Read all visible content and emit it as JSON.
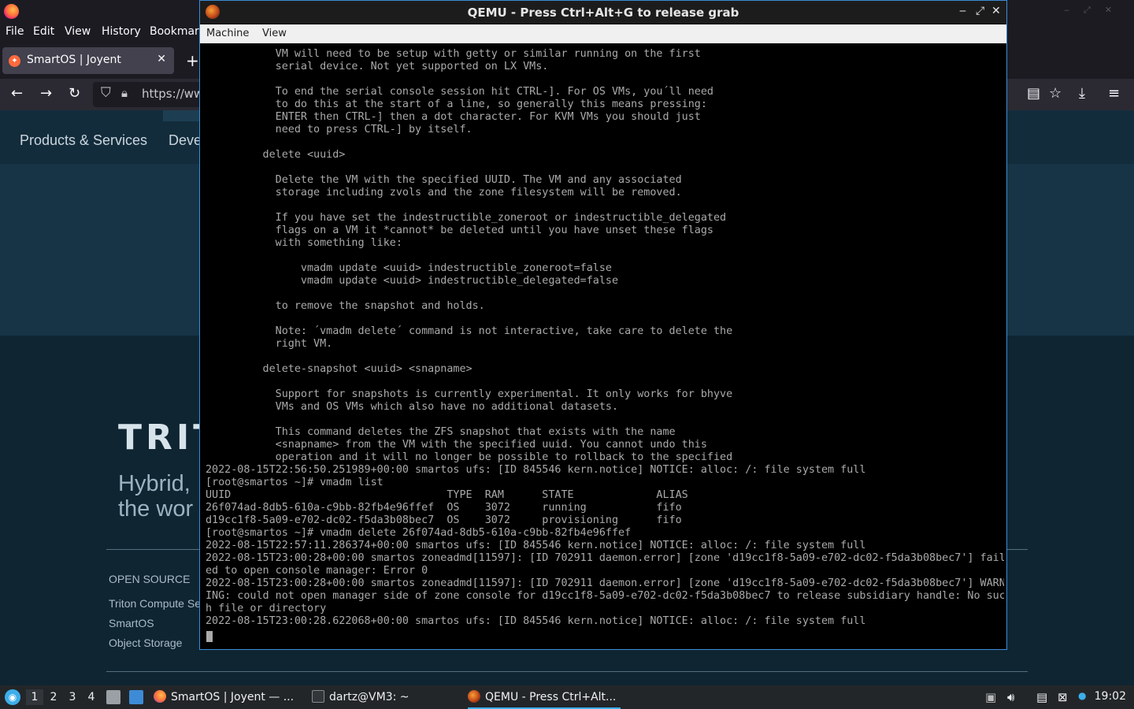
{
  "firefox": {
    "menu": [
      "File",
      "Edit",
      "View",
      "History",
      "Bookmarks"
    ],
    "tab_title": "SmartOS | Joyent",
    "tab_close": "✕",
    "new_tab": "+",
    "url": "https://www",
    "nav_icons": {
      "back": "←",
      "forward": "→",
      "reload": "↻",
      "reader": "▤",
      "bookmark": "☆",
      "download": "⤓",
      "menu": "≡"
    }
  },
  "page": {
    "nav": [
      "Products & Services",
      "Deve"
    ],
    "logo": "TRIT",
    "hero_lines": [
      "Hybrid,",
      "the wor"
    ],
    "open_source_heading": "OPEN SOURCE",
    "open_source_links": [
      "Triton Compute Se",
      "SmartOS",
      "Object Storage"
    ]
  },
  "qemu": {
    "title": "QEMU - Press Ctrl+Alt+G to release grab",
    "controls": {
      "minimize": "‒",
      "maximize": "⤢",
      "close": "✕"
    },
    "menu": [
      "Machine",
      "View"
    ],
    "console_lines": [
      "           VM will need to be setup with getty or similar running on the first",
      "           serial device. Not yet supported on LX VMs.",
      "",
      "           To end the serial console session hit CTRL-]. For OS VMs, you´ll need",
      "           to do this at the start of a line, so generally this means pressing:",
      "           ENTER then CTRL-] then a dot character. For KVM VMs you should just",
      "           need to press CTRL-] by itself.",
      "",
      "         delete <uuid>",
      "",
      "           Delete the VM with the specified UUID. The VM and any associated",
      "           storage including zvols and the zone filesystem will be removed.",
      "",
      "           If you have set the indestructible_zoneroot or indestructible_delegated",
      "           flags on a VM it *cannot* be deleted until you have unset these flags",
      "           with something like:",
      "",
      "               vmadm update <uuid> indestructible_zoneroot=false",
      "               vmadm update <uuid> indestructible_delegated=false",
      "",
      "           to remove the snapshot and holds.",
      "",
      "           Note: ´vmadm delete´ command is not interactive, take care to delete the",
      "           right VM.",
      "",
      "         delete-snapshot <uuid> <snapname>",
      "",
      "           Support for snapshots is currently experimental. It only works for bhyve",
      "           VMs and OS VMs which also have no additional datasets.",
      "",
      "           This command deletes the ZFS snapshot that exists with the name",
      "           <snapname> from the VM with the specified uuid. You cannot undo this",
      "           operation and it will no longer be possible to rollback to the specified",
      "2022-08-15T22:56:50.251989+00:00 smartos ufs: [ID 845546 kern.notice] NOTICE: alloc: /: file system full",
      "[root@smartos ~]# vmadm list",
      "UUID                                  TYPE  RAM      STATE             ALIAS",
      "26f074ad-8db5-610a-c9bb-82fb4e96ffef  OS    3072     running           fifo",
      "d19cc1f8-5a09-e702-dc02-f5da3b08bec7  OS    3072     provisioning      fifo",
      "[root@smartos ~]# vmadm delete 26f074ad-8db5-610a-c9bb-82fb4e96ffef",
      "2022-08-15T22:57:11.286374+00:00 smartos ufs: [ID 845546 kern.notice] NOTICE: alloc: /: file system full",
      "2022-08-15T23:00:28+00:00 smartos zoneadmd[11597]: [ID 702911 daemon.error] [zone 'd19cc1f8-5a09-e702-dc02-f5da3b08bec7'] fail",
      "ed to open console manager: Error 0",
      "2022-08-15T23:00:28+00:00 smartos zoneadmd[11597]: [ID 702911 daemon.error] [zone 'd19cc1f8-5a09-e702-dc02-f5da3b08bec7'] WARN",
      "ING: could not open manager side of zone console for d19cc1f8-5a09-e702-dc02-f5da3b08bec7 to release subsidiary handle: No suc",
      "h file or directory",
      "2022-08-15T23:00:28.622068+00:00 smartos ufs: [ID 845546 kern.notice] NOTICE: alloc: /: file system full"
    ]
  },
  "taskbar": {
    "workspaces": [
      "1",
      "2",
      "3",
      "4"
    ],
    "tasks": [
      "SmartOS | Joyent — ...",
      "dartz@VM3: ~",
      "QEMU - Press Ctrl+Alt..."
    ],
    "clock": "19:02"
  }
}
